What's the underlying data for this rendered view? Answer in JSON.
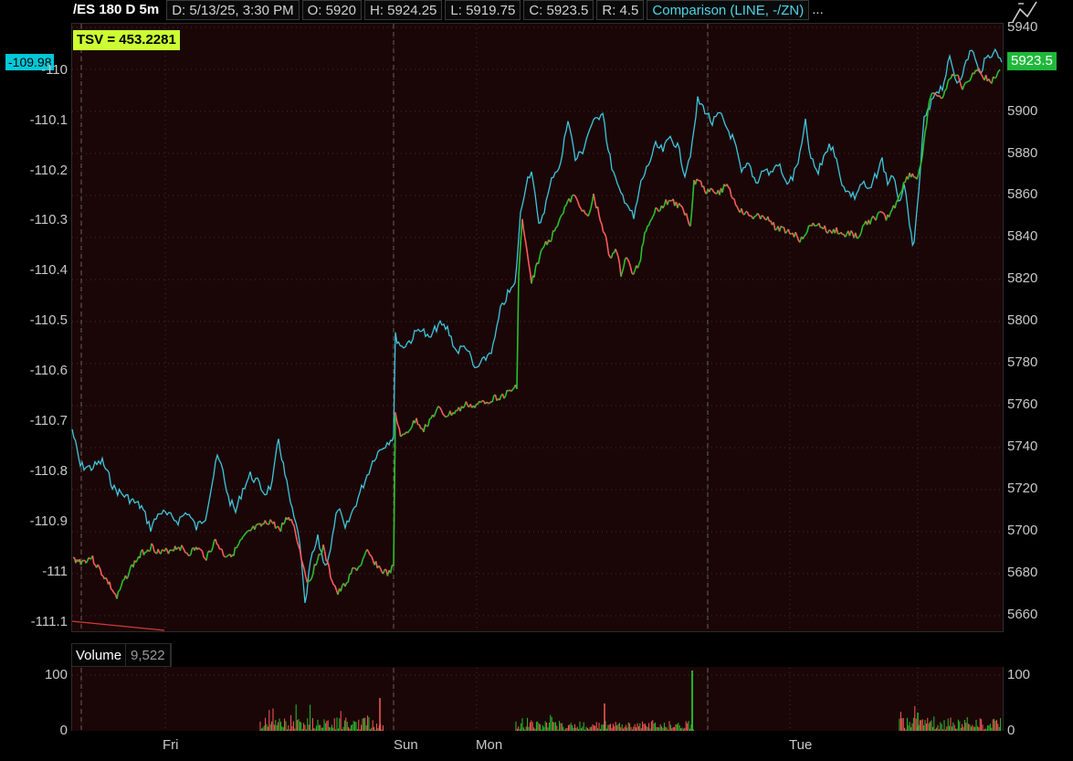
{
  "header": {
    "symbol": "/ES 180 D 5m",
    "date": "D: 5/13/25, 3:30 PM",
    "open": "O: 5920",
    "high": "H: 5924.25",
    "low": "L: 5919.75",
    "close": "C: 5923.5",
    "range": "R: 4.5",
    "comparison": "Comparison (LINE, -/ZN)",
    "more": "..."
  },
  "study": {
    "tsv_label": "TSV  = 453.2281"
  },
  "badges": {
    "comparison_value": "-109.98",
    "last_price": "5923.5"
  },
  "left_axis": {
    "ticks": [
      "-110",
      "-110.1",
      "-110.2",
      "-110.3",
      "-110.4",
      "-110.5",
      "-110.6",
      "-110.7",
      "-110.8",
      "-110.9",
      "-111",
      "-111.1"
    ]
  },
  "right_axis": {
    "ticks": [
      "5940",
      "5920",
      "5900",
      "5880",
      "5860",
      "5840",
      "5820",
      "5800",
      "5780",
      "5760",
      "5740",
      "5720",
      "5700",
      "5680",
      "5660"
    ]
  },
  "volume_panel": {
    "title": "Volume",
    "value": "9,522",
    "tick_left": "100",
    "tick_left_zero": "0",
    "tick_right": "100",
    "tick_right_zero": "0"
  },
  "x_axis": {
    "labels": [
      "Fri",
      "Sun",
      "Mon",
      "Tue"
    ]
  },
  "colors": {
    "background": "#1a0607",
    "comparison_line": "#3fc6db",
    "price_up": "#28c12c",
    "price_down": "#ff5a5a",
    "tsv_badge": "#ccff33"
  },
  "chart_data": {
    "type": "line",
    "series": [
      {
        "values_comment": "ES 5m price (right axis)",
        "x": [
          "Fri",
          "Fri",
          "Fri",
          "Sun",
          "Sun",
          "Mon",
          "Mon",
          "Mon",
          "Mon",
          "Tue",
          "Tue",
          "Tue"
        ],
        "values": [
          5682,
          5690,
          5700,
          5745,
          5755,
          5765,
          5830,
          5850,
          5865,
          5845,
          5860,
          5923.5
        ]
      }
    ],
    "y_right_range": [
      5655,
      5945
    ],
    "y_left_range": [
      -111.1,
      -109.95
    ],
    "grid": true
  }
}
